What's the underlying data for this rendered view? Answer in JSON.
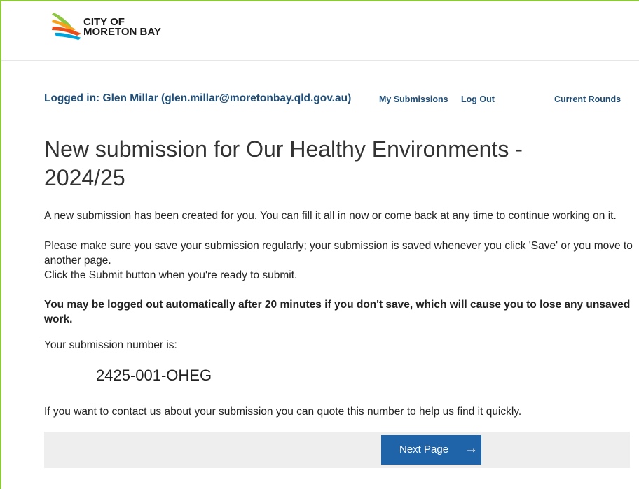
{
  "header": {
    "logo_line1": "CITY OF",
    "logo_line2": "MORETON BAY"
  },
  "userbar": {
    "logged_in": "Logged in: Glen Millar (glen.millar@moretonbay.qld.gov.au)",
    "my_submissions": "My Submissions",
    "log_out": "Log Out",
    "current_rounds": "Current Rounds"
  },
  "main": {
    "title": "New submission for Our Healthy Environments - 2024/25",
    "intro_1": "A new submission has been created for you. You can fill it all in now or come back at any time to continue working on it.",
    "intro_2": "Please make sure you save your submission regularly; your submission is saved whenever you click 'Save' or you move to another page.",
    "intro_3": "Click the Submit button when you're ready to submit.",
    "warning": "You may be logged out automatically after 20 minutes if you don't save, which will cause you to lose any unsaved work.",
    "number_label": "Your submission number is:",
    "submission_number": "2425-001-OHEG",
    "contact_note": "If you want to contact us about your submission you can quote this number to help us find it quickly."
  },
  "footer": {
    "next_label": "Next Page",
    "next_icon": "arrow-right-icon"
  },
  "colors": {
    "accent_blue": "#1f63a8",
    "link_navy": "#1f4e79",
    "frame_green": "#8dc63f",
    "footer_bg": "#eeeeee"
  }
}
